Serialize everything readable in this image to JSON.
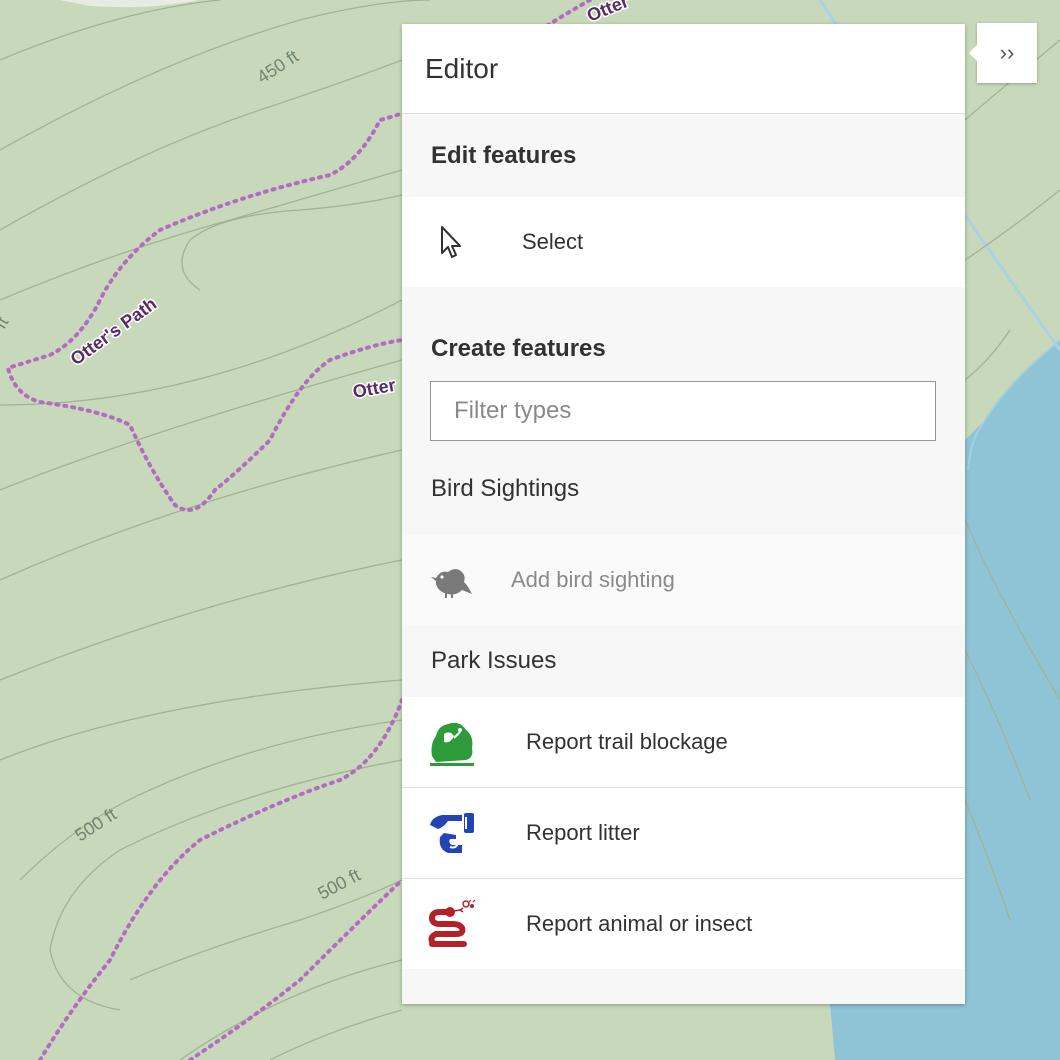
{
  "map": {
    "contour_labels": [
      "450 ft",
      "500 ft",
      "500 ft",
      "ft"
    ],
    "trail_labels": [
      "Otter's Path",
      "Otter",
      "Otter"
    ]
  },
  "panel": {
    "collapse_glyph": "››",
    "title": "Editor",
    "edit_features": {
      "title": "Edit features",
      "select_label": "Select",
      "select_icon": "cursor-icon"
    },
    "create_features": {
      "title": "Create features",
      "filter_placeholder": "Filter types",
      "filter_value": ""
    },
    "groups": [
      {
        "title": "Bird Sightings",
        "items": [
          {
            "label": "Add bird sighting",
            "icon": "bird-icon",
            "enabled": false
          }
        ]
      },
      {
        "title": "Park Issues",
        "items": [
          {
            "label": "Report trail blockage",
            "icon": "trail-blockage-icon",
            "enabled": true
          },
          {
            "label": "Report litter",
            "icon": "litter-icon",
            "enabled": true
          },
          {
            "label": "Report animal or insect",
            "icon": "snake-icon",
            "enabled": true
          }
        ]
      }
    ]
  },
  "colors": {
    "land": "#c7d9ba",
    "water": "#8ec4d6",
    "contour": "#9fb592",
    "trail": "#b46cc2",
    "trail_label": "#5b2a64",
    "blockage_green": "#2e9a3a",
    "litter_blue": "#2444b5",
    "animal_red": "#b3222a"
  }
}
